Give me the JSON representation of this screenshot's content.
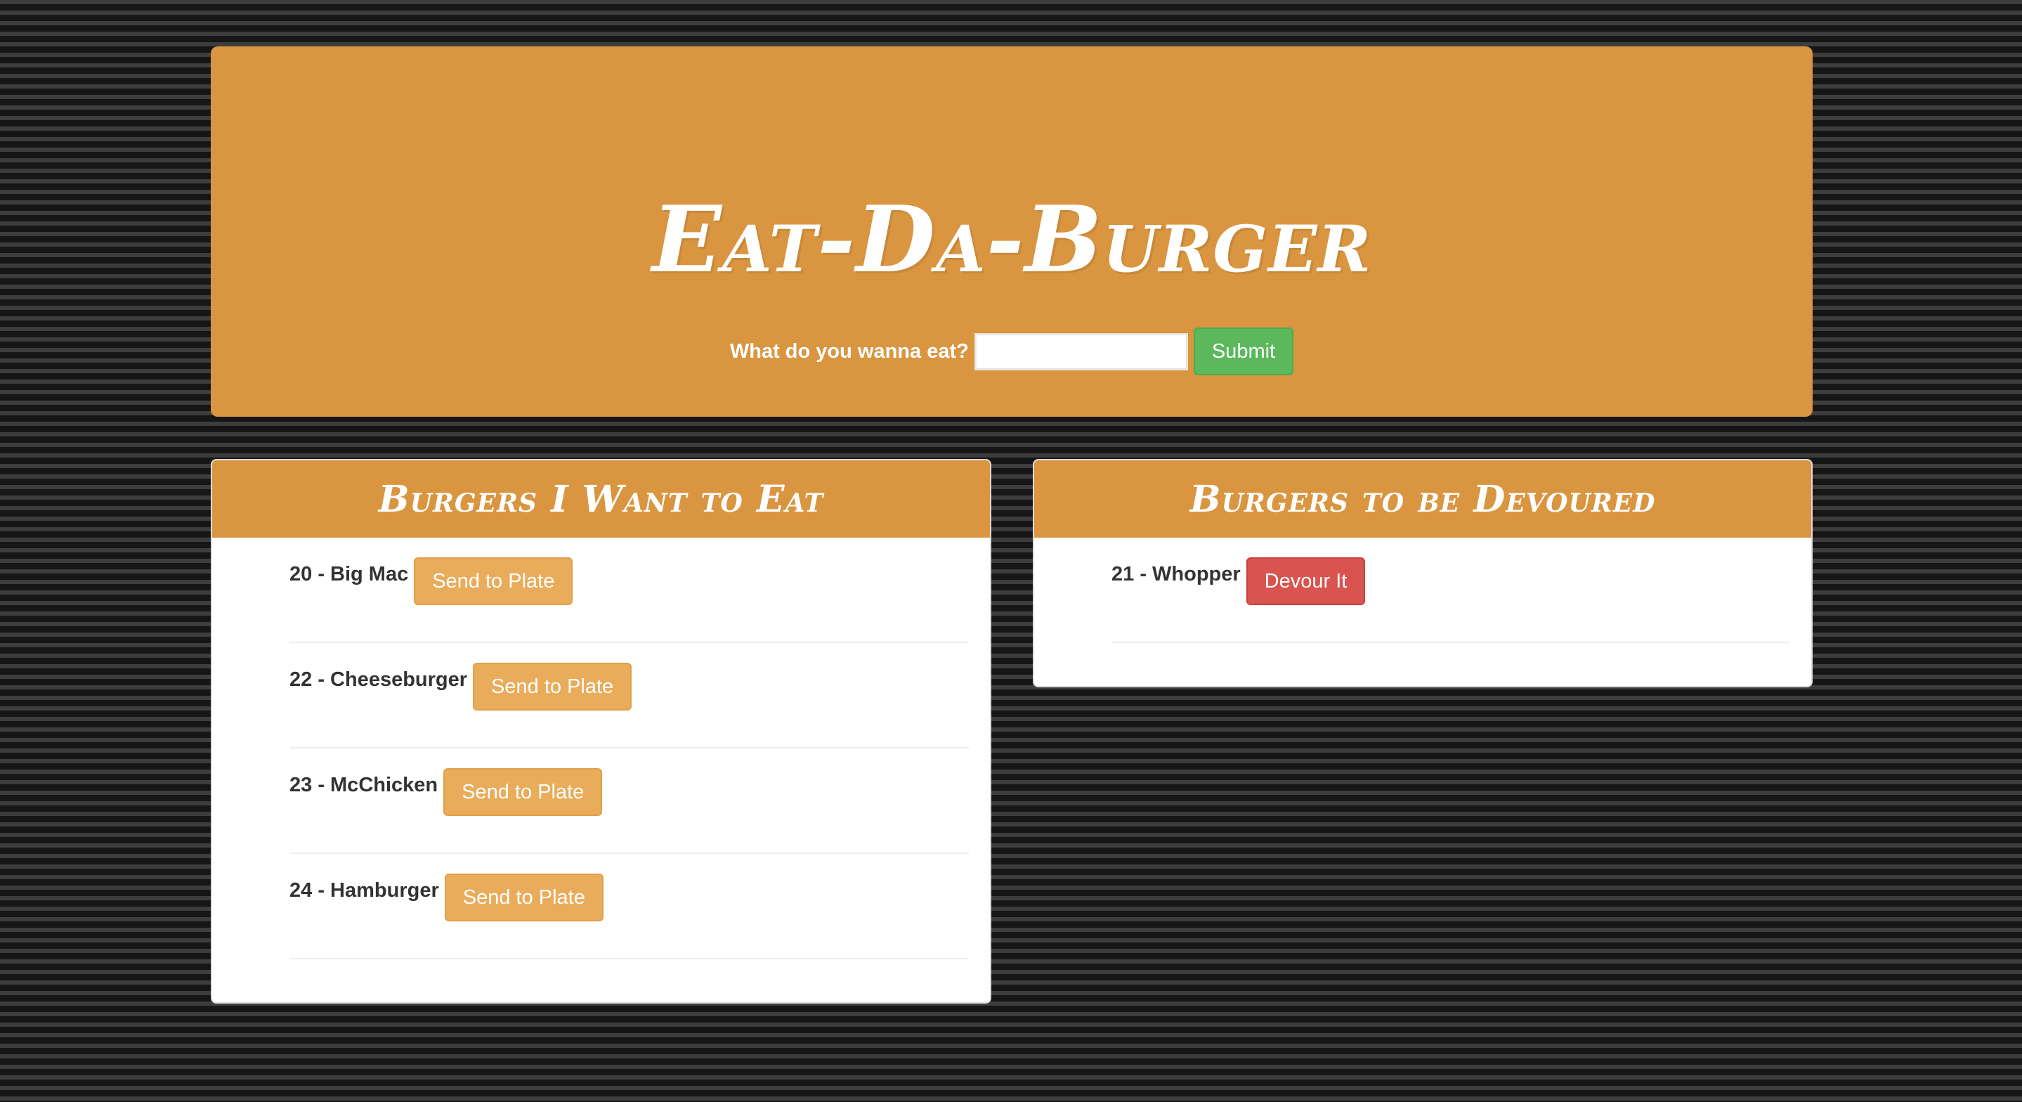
{
  "header": {
    "title": "Eat-Da-Burger",
    "form_label": "What do you wanna eat?",
    "input_value": "",
    "submit_label": "Submit"
  },
  "to_eat": {
    "title": "Burgers I Want to Eat",
    "items": [
      {
        "name": "20 - Big Mac",
        "button": "Send to Plate"
      },
      {
        "name": "22 - Cheeseburger",
        "button": "Send to Plate"
      },
      {
        "name": "23 - McChicken",
        "button": "Send to Plate"
      },
      {
        "name": "24 - Hamburger",
        "button": "Send to Plate"
      }
    ]
  },
  "devoured": {
    "title": "Burgers to be Devoured",
    "items": [
      {
        "name": "21 - Whopper",
        "button": "Devour It"
      }
    ]
  },
  "colors": {
    "accent": "#d9953f",
    "submit": "#5cb85c",
    "send_button": "#e8ac5b",
    "devour_button": "#d9534f"
  }
}
